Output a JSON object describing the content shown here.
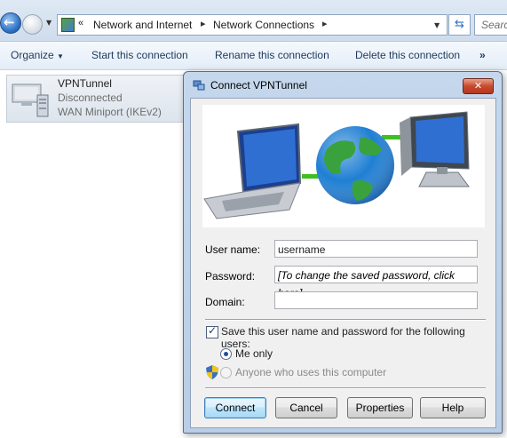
{
  "explorer": {
    "breadcrumb": {
      "overflow": "«",
      "items": [
        "Network and Internet",
        "Network Connections"
      ]
    },
    "search_placeholder": "Search"
  },
  "commands": {
    "organize": "Organize",
    "start": "Start this connection",
    "rename": "Rename this connection",
    "delete": "Delete this connection",
    "more": "»"
  },
  "connection": {
    "name": "VPNTunnel",
    "status": "Disconnected",
    "device": "WAN Miniport (IKEv2)"
  },
  "dialog": {
    "title": "Connect VPNTunnel",
    "close_glyph": "✕",
    "labels": {
      "username": "User name:",
      "password": "Password:",
      "domain": "Domain:"
    },
    "values": {
      "username": "username",
      "password": "[To change the saved password, click here]",
      "domain": ""
    },
    "save_checkbox": {
      "label": "Save this user name and password for the following users:",
      "checked": true
    },
    "radio_options": [
      {
        "label": "Me only",
        "selected": true,
        "enabled": true
      },
      {
        "label": "Anyone who uses this computer",
        "selected": false,
        "enabled": false
      }
    ],
    "buttons": {
      "connect": "Connect",
      "cancel": "Cancel",
      "properties": "Properties",
      "help": "Help"
    }
  },
  "colors": {
    "accent": "#1e395b",
    "dialog_frame": "#b9cde6",
    "close_button": "#c74a2e",
    "link_line": "#3fbf1f"
  }
}
